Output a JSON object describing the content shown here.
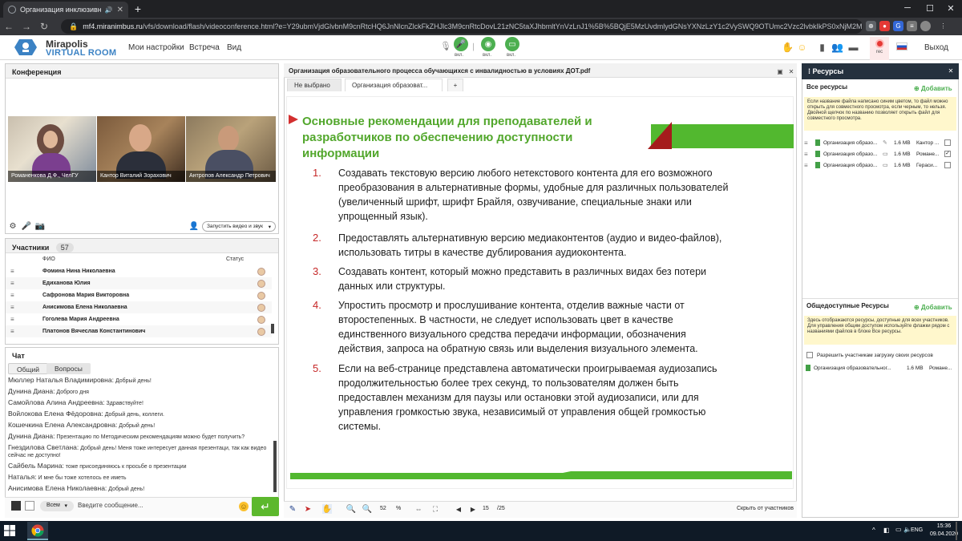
{
  "browser": {
    "tab_title": "Организация инклюзивно",
    "url_host": "mf4.miranimbus.ru",
    "url_path": "/vfs/download/flash/videoconference.html?e=Y29ubmVjdGlvbnM9cnRtcHQ6JnNlcnZlckFkZHJlc3M9cnRtcDovL21zNC5taXJhbmltYnVzLnJ1%5B%5BQjE5MzUvdmlydGNsYXNzLzY1c2VySWQ9OTUmc2Vzc2lvbkIkPS0xNjM2MT...",
    "minimize": "─",
    "maximize": "☐",
    "close": "✕"
  },
  "app": {
    "logo_line1": "Mirapolis",
    "logo_line2": "VIRTUAL ROOM",
    "menu": [
      "Мои настройки",
      "Встреча",
      "Вид"
    ],
    "device_labels": [
      "вкл.",
      "вкл.",
      "вкл."
    ],
    "rec_label": "rec",
    "exit_label": "Выход"
  },
  "conference": {
    "title": "Конференция",
    "videos": [
      "Романенкова Д.Ф., ЧелГУ",
      "Кантор Виталий Зорахович",
      "Антропов Александр  Петрович"
    ],
    "start_video_label": "Запустить видео и звук"
  },
  "participants": {
    "title": "Участники",
    "count": "57",
    "col_name": "ФИО",
    "col_status": "Статус",
    "rows": [
      "Фомина Нина Николаевна",
      "Едиханова Юлия",
      "Сафронова Мария Викторовна",
      "Анисимова Елена  Николаевна",
      "Гоголева  Мария  Андреевна",
      "Платонов Вячеслав  Константинович"
    ]
  },
  "chat": {
    "title": "Чат",
    "tabs": [
      "Общий",
      "Вопросы"
    ],
    "messages": [
      {
        "who": "Мюллер Наталья Владимировна:",
        "text": "Добрый день!"
      },
      {
        "who": "Дунина Диана:",
        "text": "Доброго дня"
      },
      {
        "who": "Самойлова Алина  Андреевна:",
        "text": "Здравствуйте!"
      },
      {
        "who": "Войлокова Елена Фёдоровна:",
        "text": "Добрый день, коллеги."
      },
      {
        "who": "Кошечкина Елена Александровна:",
        "text": "Добрый день!"
      },
      {
        "who": "Дунина Диана:",
        "text": "Презентацию по Методическим рекомендациям можно будет получить?"
      },
      {
        "who": "Гнездилова Светлана:",
        "text": "Добрый день! Меня тоже интересует данная презентаци, так как видео сейчас не доступно!"
      },
      {
        "who": "Сайбель Марина:",
        "text": "тоже присоединяюсь к просьбе о презентации"
      },
      {
        "who": "Наталья:",
        "text": "И мне бы тоже хотелось ее иметь"
      },
      {
        "who": "Анисимова Елена  Николаевна:",
        "text": "Добрый день!"
      }
    ],
    "recipient": "Всем",
    "input_placeholder": "Введите сообщение..."
  },
  "document": {
    "title": "Организация образовательного процесса обучающихся с инвалидностью в условиях ДОТ.pdf",
    "tabs": [
      "Не выбрано",
      "Организация образоват...",
      "+"
    ],
    "slide_title": "Основные рекомендации для преподавателей и разработчиков по обеспечению доступности информации",
    "items": [
      {
        "n": "1.",
        "text": "Создавать текстовую версию любого нетекстового контента для его возможного преобразования в альтернативные формы, удобные для различных пользователей (увеличенный шрифт, шрифт Брайля, озвучивание, специальные знаки или упрощенный язык)."
      },
      {
        "n": "2.",
        "text": "Предоставлять альтернативную версию медиаконтентов (аудио и видео-файлов), использовать титры в качестве дублирования аудиоконтента."
      },
      {
        "n": "3.",
        "text": "Создавать контент, который можно представить в различных видах без потери данных или структуры."
      },
      {
        "n": "4.",
        "text": "Упростить просмотр и прослушивание контента, отделив важные части от второстепенных. В частности, не следует использовать цвет в качестве единственного визуального средства передачи информации, обозначения действия, запроса на обратную связь или выделения визуального элемента."
      },
      {
        "n": "5.",
        "text": "Если на веб-странице представлена автоматически проигрываемая аудиозапись продолжительностью более трех секунд, то пользователям должен быть предоставлен механизм для паузы или остановки этой аудиозаписи, или для управления громкостью звука, независимый от управления общей громкостью системы."
      }
    ],
    "zoom": "52",
    "zoom_unit": "%",
    "page": "15",
    "pages": "/25",
    "hide_label": "Скрыть от участников"
  },
  "resources": {
    "title": "Ресурсы",
    "all_title": "Все ресурсы",
    "add_label": "Добавить",
    "all_note": "Если название файла написано синим цветом, то файл можно открыть для совместного просмотра, если черным, то нельзя. Двойной щелчок по названию позволяет открыть файл для совместного просмотра.",
    "files": [
      {
        "name": "Организация образо...",
        "size": "1.6 MB",
        "owner": "Кантор ..."
      },
      {
        "name": "Организация образо...",
        "size": "1.6 MB",
        "owner": "Романе..."
      },
      {
        "name": "Организация образо...",
        "size": "1.6 MB",
        "owner": "Гераси..."
      }
    ],
    "public_title": "Общедоступные Ресурсы",
    "public_note": "Здесь отображаются ресурсы, доступные для всех участников. Для управления общим доступом используйте флажки рядом с названиями файлов в блоке Все ресурсы.",
    "allow_upload": "Разрешить участникам загрузку своих ресурсов",
    "public_file": {
      "name": "Организация образовательног...",
      "size": "1.6 MB",
      "owner": "Романе..."
    }
  },
  "taskbar": {
    "lang": "ENG",
    "time": "15:36",
    "date": "09.04.2020"
  }
}
